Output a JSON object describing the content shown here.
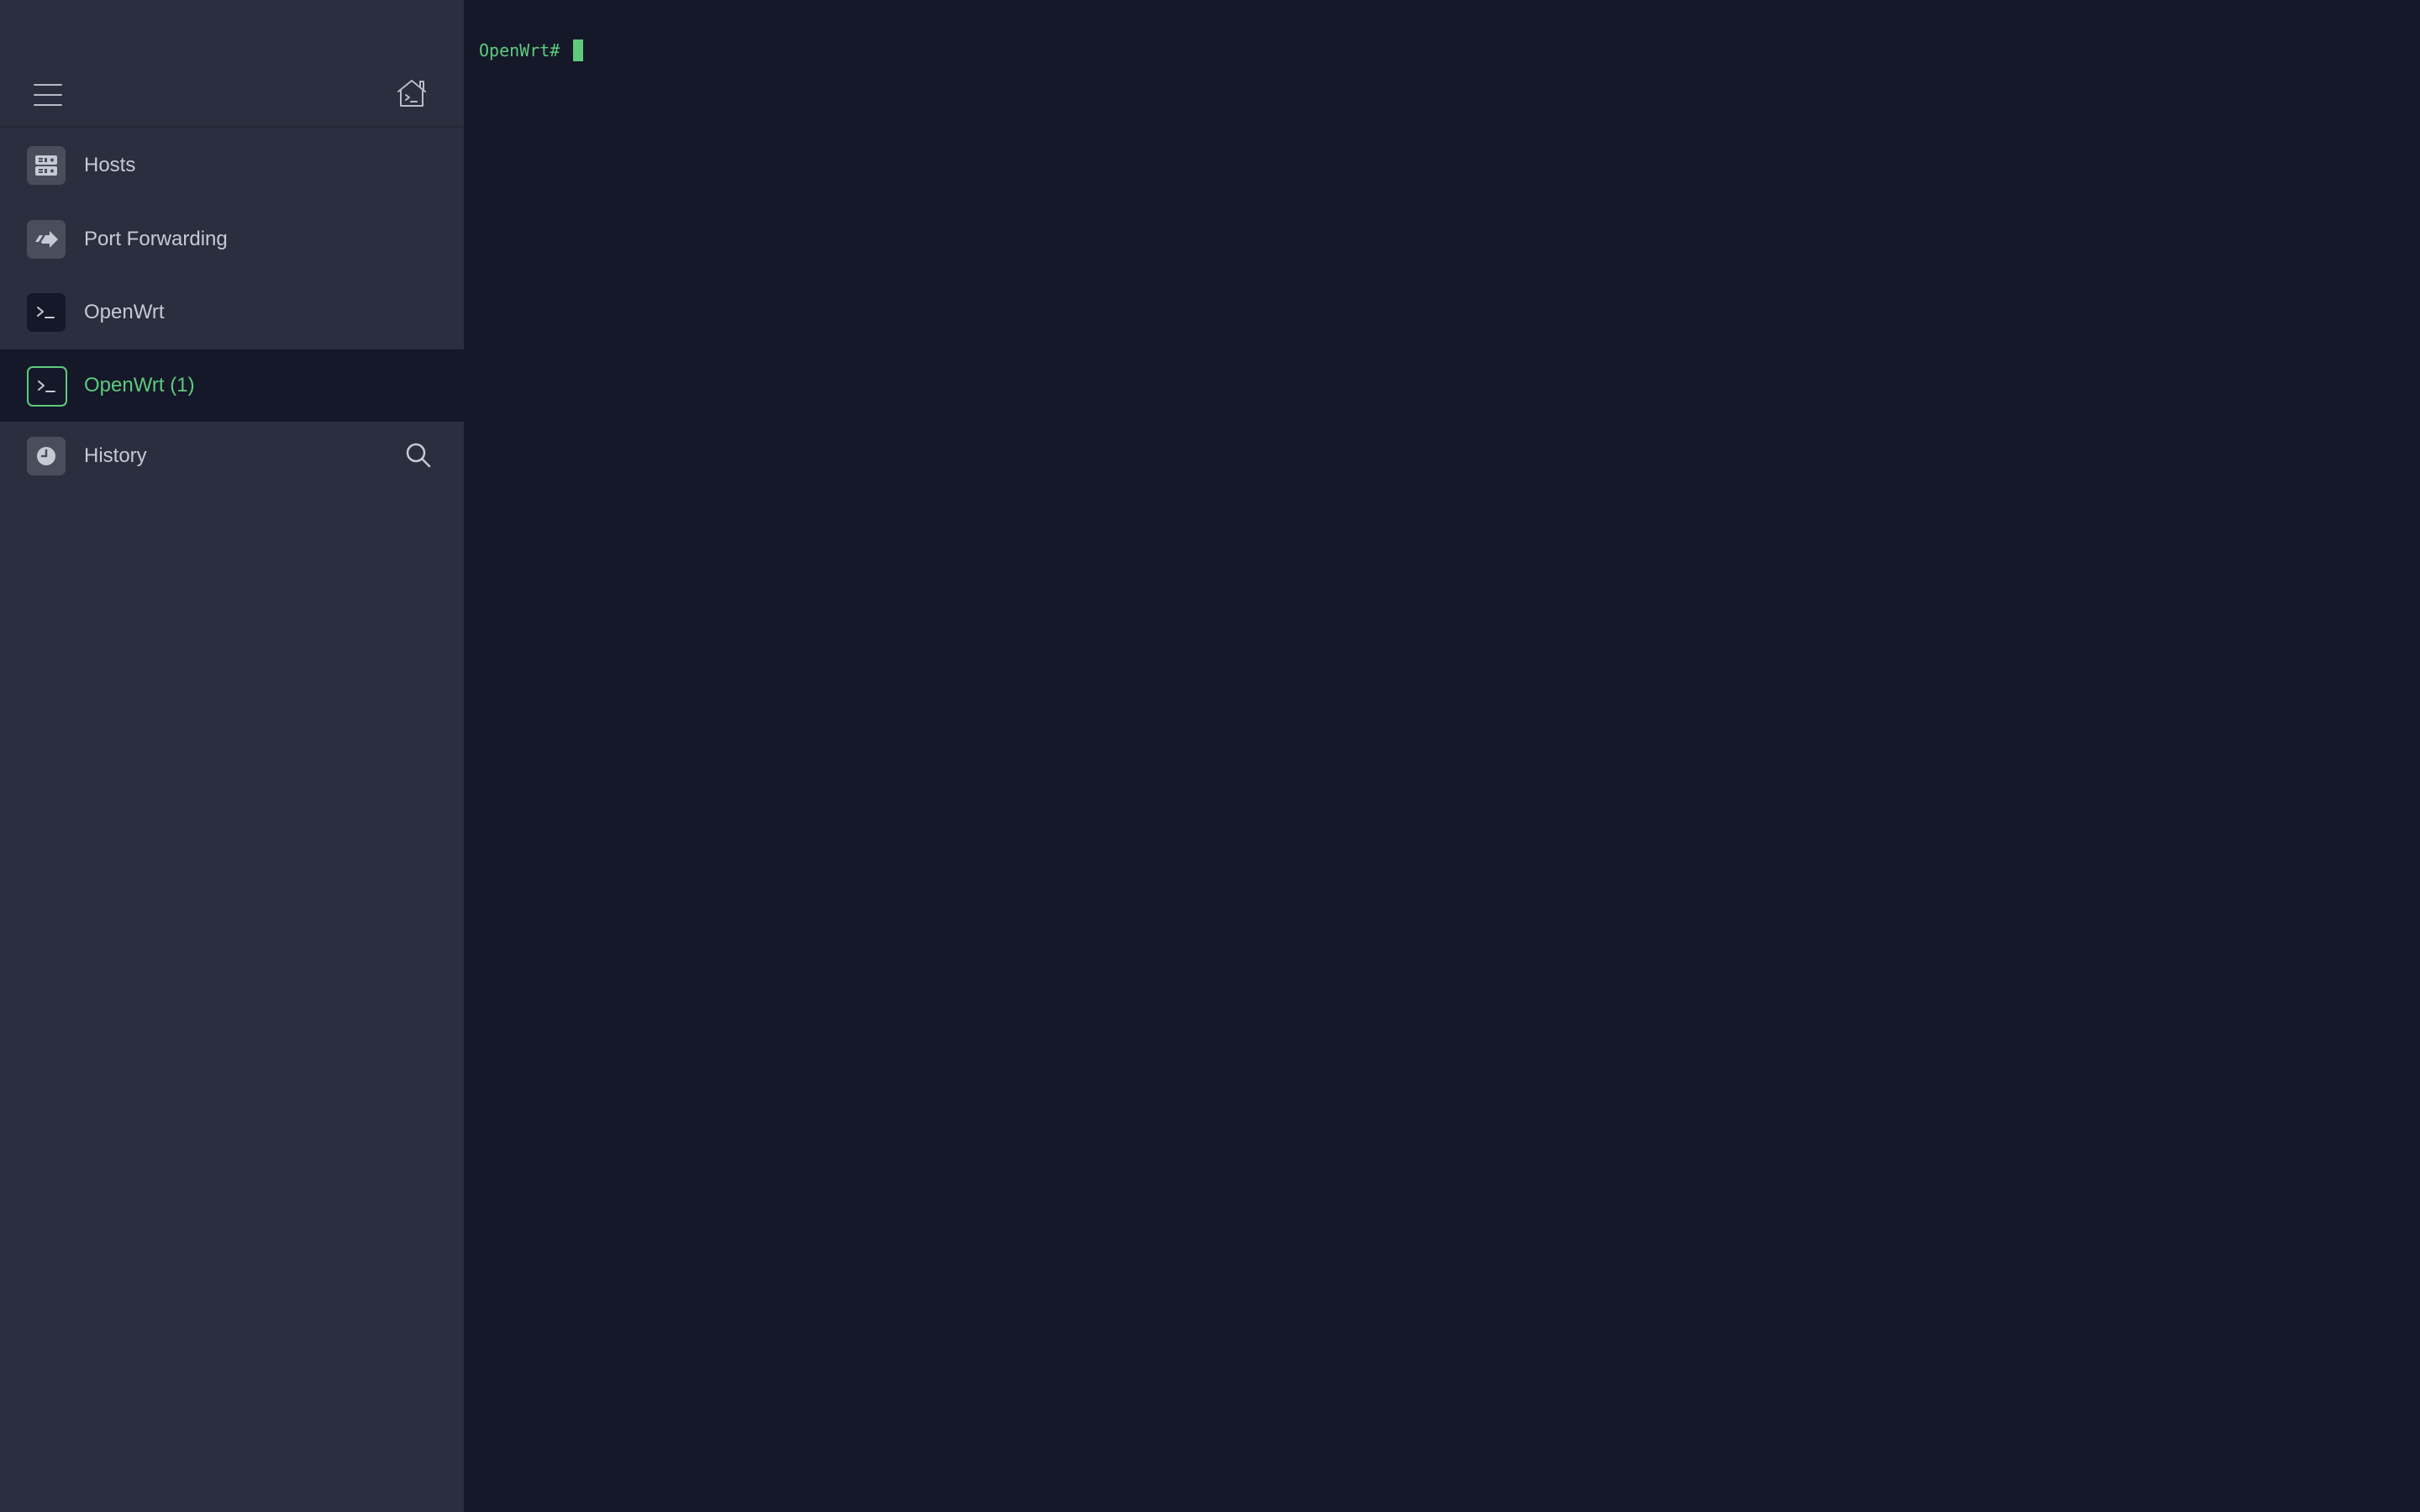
{
  "sidebar": {
    "items": [
      {
        "label": "Hosts",
        "icon": "hosts-icon"
      },
      {
        "label": "Port Forwarding",
        "icon": "port-forwarding-icon"
      },
      {
        "label": "OpenWrt",
        "icon": "terminal-icon"
      },
      {
        "label": "OpenWrt (1)",
        "icon": "terminal-icon",
        "active": true
      },
      {
        "label": "History",
        "icon": "history-icon"
      }
    ]
  },
  "terminal": {
    "prompt": "OpenWrt#"
  },
  "colors": {
    "accent": "#5ecb7c",
    "sidebar_bg": "#2a2e3e",
    "terminal_bg": "#141829"
  }
}
